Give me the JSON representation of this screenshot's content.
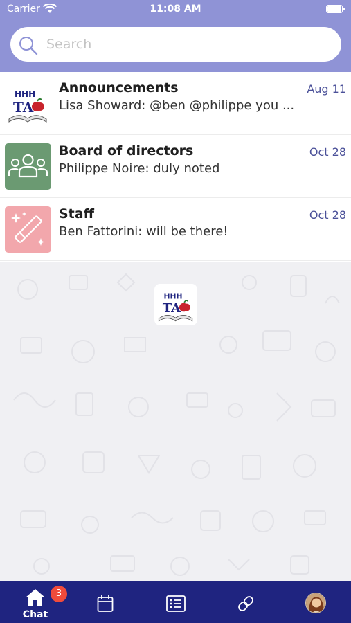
{
  "status_bar": {
    "carrier": "Carrier",
    "time": "11:08 AM"
  },
  "search": {
    "placeholder": "Search"
  },
  "chats": [
    {
      "name": "Announcements",
      "preview": "Lisa Showard: @ben @philippe you ...",
      "date": "Aug 11",
      "avatar": "hhh-ta-logo"
    },
    {
      "name": "Board of directors",
      "preview": "Philippe Noire: duly noted",
      "date": "Oct 28",
      "avatar": "group-icon",
      "avatar_color": "#6b9a72"
    },
    {
      "name": "Staff",
      "preview": "Ben Fattorini: will be there!",
      "date": "Oct 28",
      "avatar": "magic-wand-icon",
      "avatar_color": "#f2a7ac"
    }
  ],
  "logo": {
    "text_top": "HHH",
    "text_bottom": "TA"
  },
  "tab_bar": {
    "chat_label": "Chat",
    "chat_badge": "3",
    "icons": [
      "home-icon",
      "calendar-icon",
      "list-icon",
      "link-icon",
      "profile-avatar"
    ]
  },
  "colors": {
    "header": "#8f93d6",
    "tab_bar": "#1f2480",
    "accent_date": "#4b5199",
    "badge": "#f04b3c"
  }
}
